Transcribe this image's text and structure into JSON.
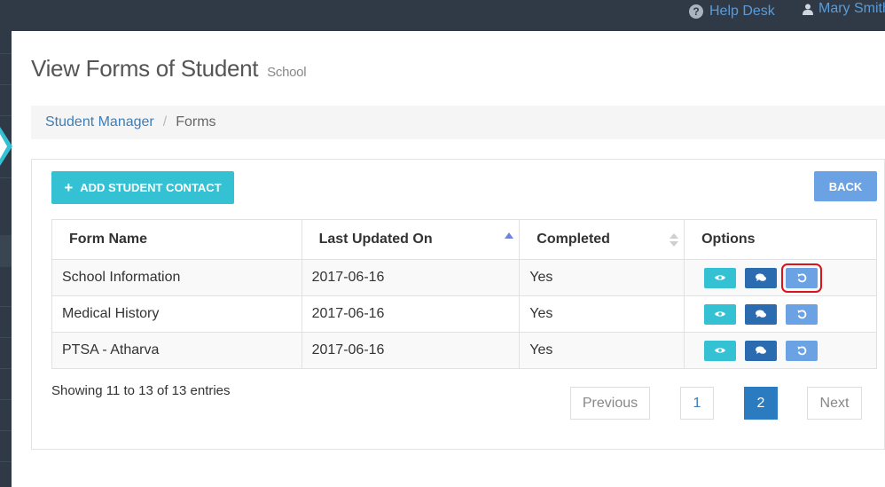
{
  "topbar": {
    "help_label": "Help Desk",
    "help_icon": "question-circle-icon",
    "user_label": "Mary Smith",
    "user_icon": "user-icon"
  },
  "page": {
    "title": "View Forms of Student",
    "subtitle": "School"
  },
  "breadcrumb": {
    "items": [
      "Student Manager",
      "Forms"
    ],
    "separator": "/"
  },
  "actions": {
    "add_label": "ADD STUDENT CONTACT",
    "back_label": "BACK"
  },
  "table": {
    "columns": [
      "Form Name",
      "Last Updated On",
      "Completed",
      "Options"
    ],
    "rows": [
      {
        "name": "School Information",
        "updated": "2017-06-16",
        "completed": "Yes"
      },
      {
        "name": "Medical History",
        "updated": "2017-06-16",
        "completed": "Yes"
      },
      {
        "name": "PTSA - Atharva",
        "updated": "2017-06-16",
        "completed": "Yes"
      }
    ],
    "option_icons": [
      "eye-icon",
      "comments-icon",
      "undo-icon"
    ]
  },
  "footer": {
    "info": "Showing 11 to 13 of 13 entries",
    "previous": "Previous",
    "pages": [
      "1",
      "2"
    ],
    "current_page": "2",
    "next": "Next"
  },
  "colors": {
    "topbar": "#2f3a46",
    "accent_cyan": "#34c1d3",
    "primary_blue": "#2b7bc0",
    "light_blue": "#6aa2e4",
    "link": "#3d7db8",
    "highlight": "#d9141a"
  }
}
